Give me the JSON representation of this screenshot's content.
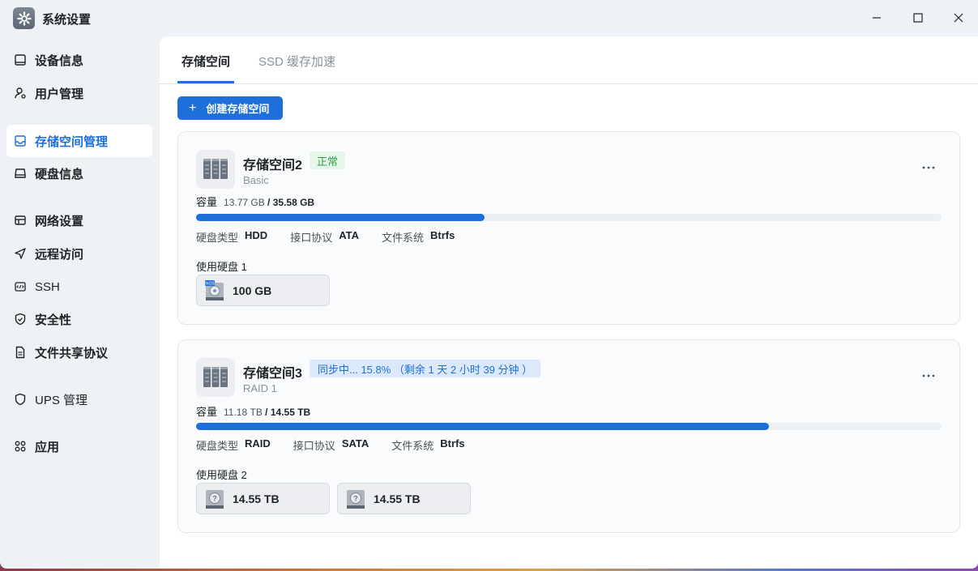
{
  "window": {
    "title": "系统设置"
  },
  "sidebar": {
    "items": [
      {
        "label": "设备信息",
        "icon": "monitor-icon"
      },
      {
        "label": "用户管理",
        "icon": "user-settings-icon"
      },
      {
        "label": "存储空间管理",
        "icon": "storage-icon",
        "active": true
      },
      {
        "label": "硬盘信息",
        "icon": "drive-icon"
      },
      {
        "label": "网络设置",
        "icon": "network-icon"
      },
      {
        "label": "远程访问",
        "icon": "send-icon"
      },
      {
        "label": "SSH",
        "icon": "terminal-icon"
      },
      {
        "label": "安全性",
        "icon": "shield-check-icon"
      },
      {
        "label": "文件共享协议",
        "icon": "document-icon"
      },
      {
        "label": "UPS 管理",
        "icon": "shield-icon"
      },
      {
        "label": "应用",
        "icon": "apps-icon"
      }
    ]
  },
  "tabs": [
    {
      "label": "存储空间",
      "active": true
    },
    {
      "label": "SSD 缓存加速",
      "active": false
    }
  ],
  "toolbar": {
    "create_label": "创建存储空间"
  },
  "pools": [
    {
      "name": "存储空间2",
      "status": "正常",
      "raid": "Basic",
      "capacity_label": "容量",
      "used": "13.77 GB",
      "total": "35.58 GB",
      "usage_fraction": 0.387,
      "disk_type_label": "硬盘类型",
      "disk_type": "HDD",
      "interface_label": "接口协议",
      "interface": "ATA",
      "fs_label": "文件系统",
      "fs": "Btrfs",
      "disks_label": "使用硬盘 1",
      "disks": [
        {
          "size": "100 GB",
          "icon": "fnos-disk-icon"
        }
      ]
    },
    {
      "name": "存储空间3",
      "status": "同步中... 15.8%  （剩余 1 天 2 小时 39 分钟 ）",
      "raid": "RAID 1",
      "capacity_label": "容量",
      "used": "11.18 TB",
      "total": "14.55 TB",
      "usage_fraction": 0.768,
      "disk_type_label": "硬盘类型",
      "disk_type": "RAID",
      "interface_label": "接口协议",
      "interface": "SATA",
      "fs_label": "文件系统",
      "fs": "Btrfs",
      "disks_label": "使用硬盘 2",
      "disks": [
        {
          "size": "14.55 TB",
          "icon": "unknown-disk-icon"
        },
        {
          "size": "14.55 TB",
          "icon": "unknown-disk-icon"
        }
      ]
    }
  ],
  "colors": {
    "accent": "#1e6fd9",
    "ok_text": "#2ea24a",
    "ok_bg": "#e6f6ea",
    "sync_bg": "#dce9fb"
  }
}
